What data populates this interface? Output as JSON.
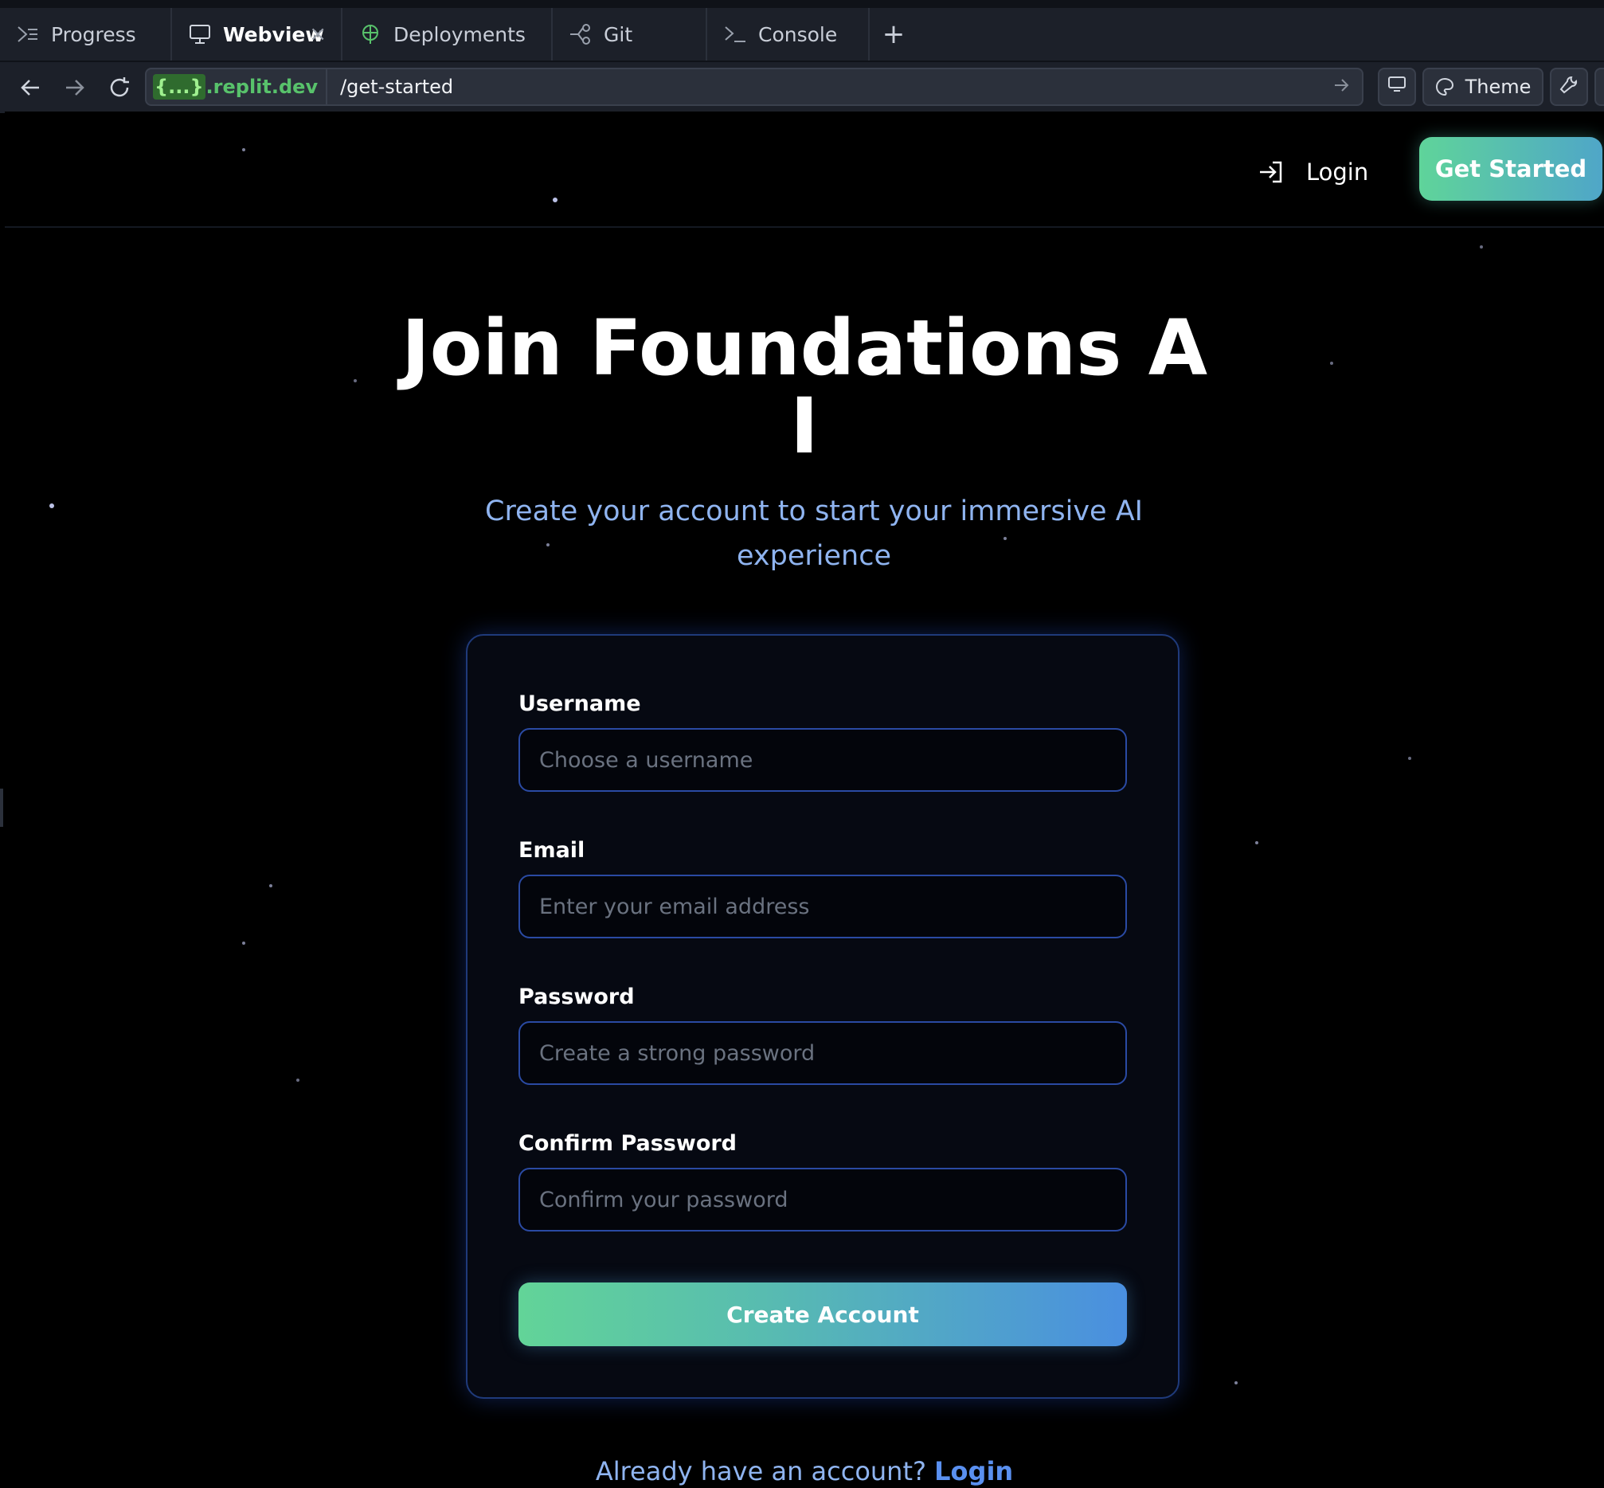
{
  "ide": {
    "tabs": [
      {
        "label": "Progress",
        "icon": "progress-icon"
      },
      {
        "label": "Webview",
        "icon": "monitor-icon",
        "active": true,
        "closable": true
      },
      {
        "label": "Deployments",
        "icon": "deployments-icon"
      },
      {
        "label": "Git",
        "icon": "git-icon"
      },
      {
        "label": "Console",
        "icon": "console-icon"
      }
    ],
    "add_tab_icon": "plus-icon",
    "address": {
      "host_chip": "{...}",
      "host_suffix": ".replit.dev",
      "path": "/get-started"
    },
    "tools": {
      "theme_label": "Theme"
    },
    "colors": {
      "host_green": "#58c26b",
      "chrome_bg": "#1c2029"
    }
  },
  "site": {
    "nav": {
      "login_label": "Login",
      "cta_label": "Get Started"
    },
    "hero": {
      "title_line1": "Join Foundations A",
      "title_line2": "I",
      "subtitle": "Create your account to start your immersive AI experience"
    },
    "form": {
      "username": {
        "label": "Username",
        "placeholder": "Choose a username"
      },
      "email": {
        "label": "Email",
        "placeholder": "Enter your email address"
      },
      "password": {
        "label": "Password",
        "placeholder": "Create a strong password"
      },
      "confirm": {
        "label": "Confirm Password",
        "placeholder": "Confirm your password"
      },
      "submit_label": "Create Account"
    },
    "footer": {
      "prompt": "Already have an account?",
      "link": "Login"
    },
    "colors": {
      "accent_green": "#5fd49a",
      "accent_blue": "#4a8fe0",
      "subtitle": "#8fb4f0"
    }
  }
}
